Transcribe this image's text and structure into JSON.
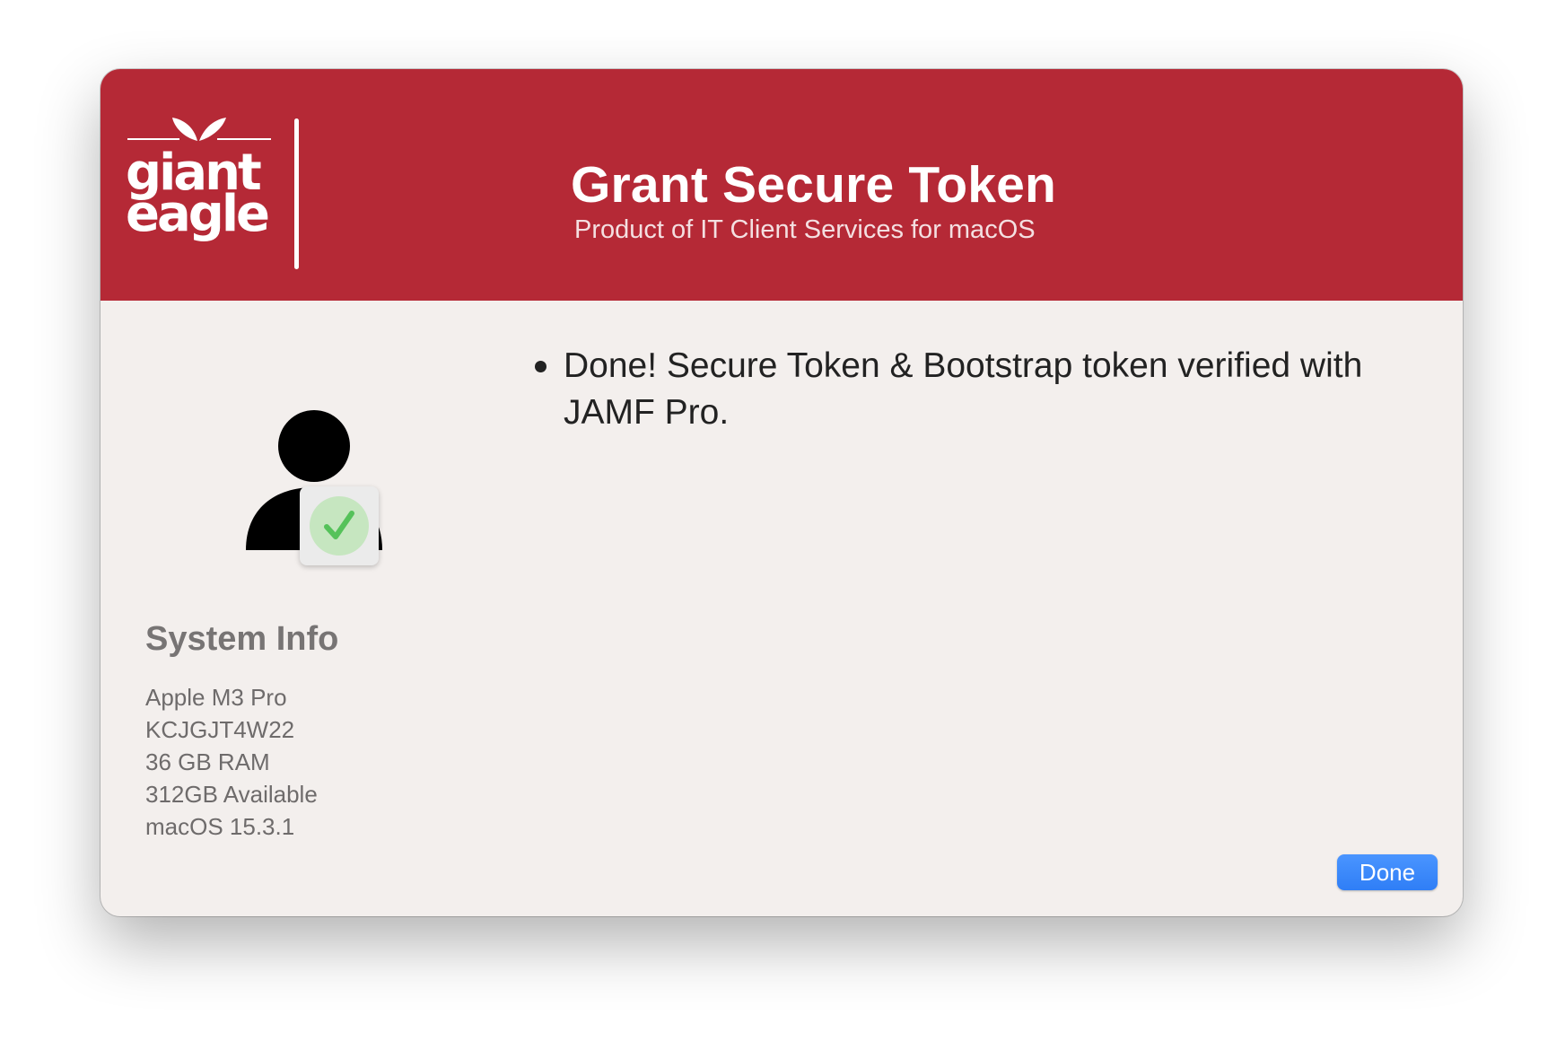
{
  "header": {
    "logo_name": "giant-eagle-logo",
    "logo_text": "giant eagle",
    "title": "Grant Secure Token",
    "subtitle": "Product of IT Client Services for macOS",
    "background_color": "#b52936"
  },
  "status": {
    "icon": "user-verified-icon",
    "badge_icon": "checkmark-icon",
    "badge_color": "#5ac85a",
    "messages": [
      "Done!  Secure Token & Bootstrap token verified with JAMF Pro."
    ]
  },
  "system_info": {
    "title": "System Info",
    "items": [
      "Apple M3 Pro",
      "KCJGJT4W22",
      "36 GB RAM",
      "312GB Available",
      "macOS 15.3.1"
    ]
  },
  "actions": {
    "done_label": "Done",
    "done_color": "#2f7ef6"
  }
}
